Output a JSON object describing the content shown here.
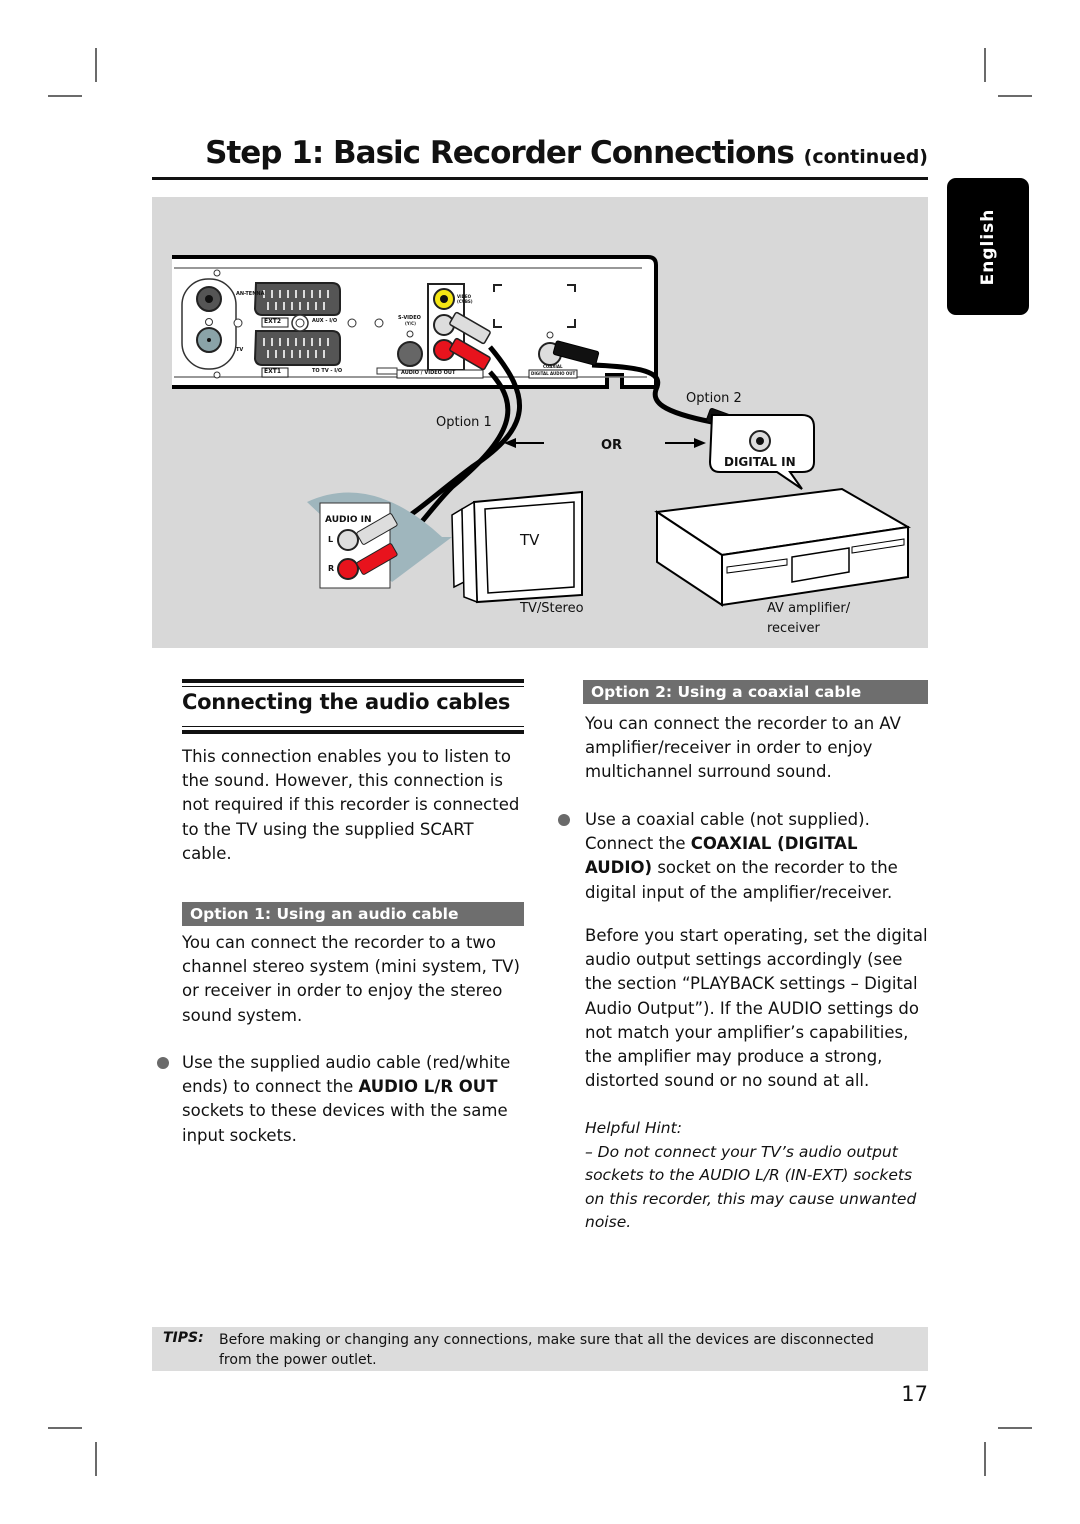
{
  "page": {
    "title_main": "Step 1: Basic Recorder Connections",
    "title_suffix": "(continued)",
    "language_tab": "English",
    "page_number": "17"
  },
  "figure": {
    "recorder_labels": {
      "antenna": "AN-TENNA",
      "tv": "TV",
      "ext2": "EXT2",
      "aux_io": "AUX - I/O",
      "ext1": "EXT1",
      "to_tv_io": "TO TV - I/O",
      "s_video": "S-VIDEO",
      "s_video_sub": "(Y/C)",
      "video": "VIDEO",
      "video_sub": "(CVBS)",
      "audio_video_out": "AUDIO / VIDEO OUT",
      "coaxial": "COAXIAL",
      "digital_audio_out": "DIGITAL AUDIO OUT"
    },
    "option1_label": "Option 1",
    "option2_label": "Option 2",
    "or_label": "OR",
    "digital_in_label": "DIGITAL IN",
    "audio_in_label": "AUDIO IN",
    "audio_in_l": "L",
    "audio_in_r": "R",
    "tv_screen_label": "TV",
    "tv_caption": "TV/Stereo",
    "amp_caption_line1": "AV amplifier/",
    "amp_caption_line2": "receiver",
    "colors": {
      "background": "#d8d8d8",
      "cable_red": "#e8131d",
      "video_yellow": "#f5e614",
      "callout_blue": "#9fb6bd"
    }
  },
  "left_column": {
    "section_title": "Connecting the audio cables",
    "intro": "This connection enables you to listen to the sound. However, this connection is not required if this recorder is connected to the TV using the supplied SCART cable.",
    "option1": {
      "heading": "Option 1: Using an audio cable",
      "description": "You can connect the recorder to a two channel stereo system (mini system, TV) or receiver in order to enjoy the stereo sound system.",
      "bullet_before": "Use the supplied audio cable (red/white ends) to connect the ",
      "bullet_bold": "AUDIO L/R OUT",
      "bullet_after": " sockets to these devices with the same input sockets."
    }
  },
  "right_column": {
    "option2": {
      "heading": "Option 2: Using a coaxial cable",
      "description": "You can connect the recorder to an AV amplifier/receiver in order to enjoy multichannel surround sound.",
      "bullet_before": "Use a coaxial cable (not supplied). Connect the ",
      "bullet_bold": "COAXIAL (DIGITAL AUDIO)",
      "bullet_after": " socket on the recorder to the digital input of the amplifier/receiver.",
      "note": "Before you start operating, set the digital audio output settings accordingly (see the section “PLAYBACK settings – Digital Audio Output”). If the AUDIO settings do not match your amplifier’s capabilities, the amplifier may produce a strong, distorted sound or no sound at all.",
      "hint_title": "Helpful Hint:",
      "hint_text": "– Do not connect your TV’s audio output sockets to the AUDIO L/R (IN-EXT) sockets on this recorder, this may cause unwanted noise."
    }
  },
  "tips": {
    "label": "TIPS:",
    "text": "Before making or changing any connections, make sure that all the devices are disconnected from the power outlet."
  }
}
